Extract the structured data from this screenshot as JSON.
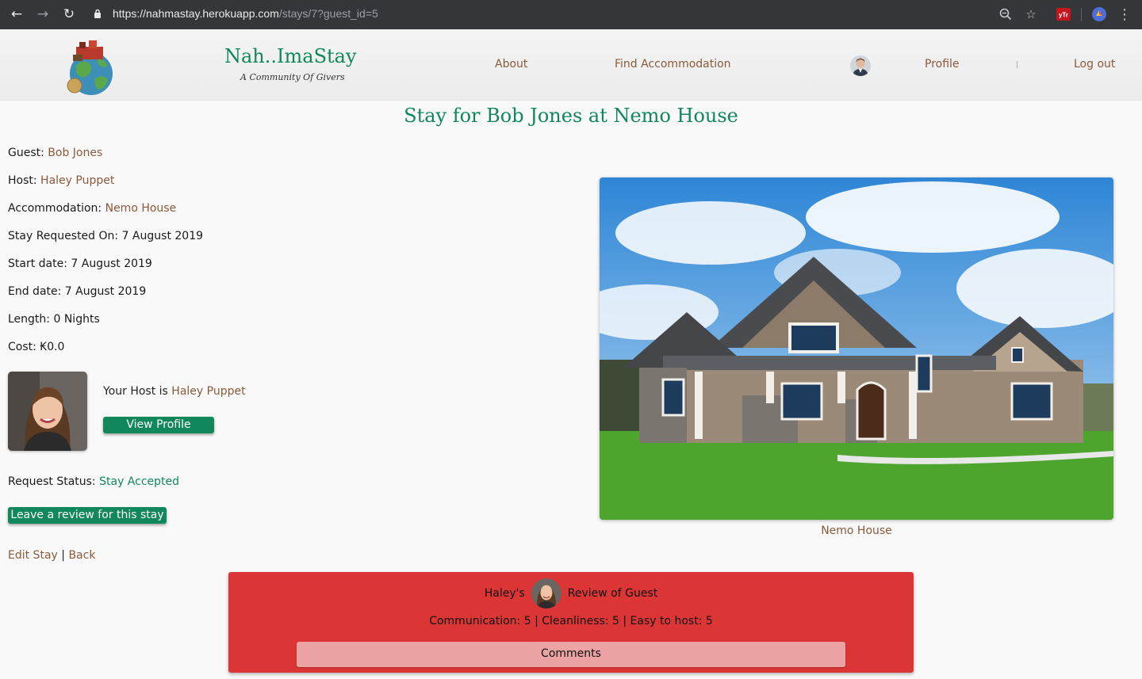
{
  "browser": {
    "url_host": "https://nahmastay.herokuapp.com",
    "url_path": "/stays/7?guest_id=5"
  },
  "header": {
    "brand_name": "Nah..ImaStay",
    "brand_tagline": "A Community Of Givers",
    "nav": {
      "about": "About",
      "find": "Find Accommodation",
      "profile": "Profile",
      "logout": "Log out"
    }
  },
  "page_title": "Stay for Bob Jones at Nemo House",
  "details": {
    "guest_label": "Guest: ",
    "guest_value": "Bob Jones",
    "host_label": "Host: ",
    "host_value": "Haley Puppet",
    "accommodation_label": "Accommodation: ",
    "accommodation_value": "Nemo House",
    "requested_label": "Stay Requested On: ",
    "requested_value": "7 August 2019",
    "start_label": "Start date: ",
    "start_value": "7 August 2019",
    "end_label": "End date: ",
    "end_value": "7 August 2019",
    "length_label": "Length: ",
    "length_value": "0 Nights",
    "cost_label": "Cost: ",
    "cost_value": "₭0.0"
  },
  "host_card": {
    "prefix": "Your Host is ",
    "name": "Haley Puppet",
    "view_profile": "View Profile"
  },
  "request_status": {
    "label": "Request Status: ",
    "value": "Stay Accepted"
  },
  "leave_review": "Leave a review for this stay",
  "links": {
    "edit": "Edit Stay",
    "separator": " | ",
    "back": "Back"
  },
  "house_caption": "Nemo House",
  "review": {
    "title_prefix": "Haley's",
    "title_suffix": "Review of Guest",
    "scores": "Communication: 5 | Cleanliness: 5 | Easy to host: 5",
    "comments": "Comments"
  },
  "colors": {
    "brand_green": "#11875c",
    "link_brown": "#8a5a3b",
    "review_red": "#dc3535"
  }
}
